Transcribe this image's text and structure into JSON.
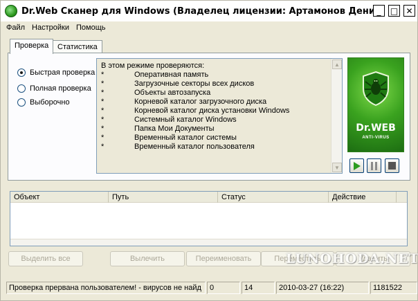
{
  "window": {
    "title": "Dr.Web Сканер для Windows (Владелец лицензии: Артамонов Денис Сергеев...",
    "minimize_glyph": "_",
    "maximize_glyph": "□",
    "close_glyph": "✕"
  },
  "menu": {
    "items": [
      "Файл",
      "Настройки",
      "Помощь"
    ]
  },
  "tabs": [
    {
      "label": "Проверка",
      "active": true
    },
    {
      "label": "Статистика",
      "active": false
    }
  ],
  "scan_modes": [
    {
      "label": "Быстрая проверка",
      "selected": true
    },
    {
      "label": "Полная проверка",
      "selected": false
    },
    {
      "label": "Выборочно",
      "selected": false
    }
  ],
  "info": {
    "heading": "В этом режиме проверяются:",
    "bullet": "*",
    "items": [
      "Оперативная память",
      "Загрузочные секторы всех дисков",
      "Объекты автозапуска",
      "Корневой каталог загрузочного диска",
      "Корневой каталог диска установки Windows",
      "Системный каталог Windows",
      "Папка Мои Документы",
      "Временный каталог системы",
      "Временный каталог пользователя"
    ]
  },
  "logo": {
    "name": "Dr.WEB",
    "subtitle": "ANTI-VIRUS",
    "colors": {
      "green": "#3aa21f",
      "dark_green": "#1d6e12"
    }
  },
  "controls": {
    "play_icon": "play-icon",
    "pause_icon": "pause-icon",
    "stop_icon": "stop-icon"
  },
  "results": {
    "columns": [
      "Объект",
      "Путь",
      "Статус",
      "Действие"
    ],
    "rows": []
  },
  "actions": {
    "select_all": "Выделить все",
    "cure": "Вылечить",
    "rename": "Переименовать",
    "move": "Переместить",
    "delete": "Удалить"
  },
  "status": {
    "message": "Проверка прервана пользователем! - вирусов не найд",
    "count1": "0",
    "count2": "14",
    "datetime": "2010-03-27 (16:22)",
    "bases": "1181522"
  },
  "watermark": {
    "text": "LUNOHODA.NET"
  }
}
